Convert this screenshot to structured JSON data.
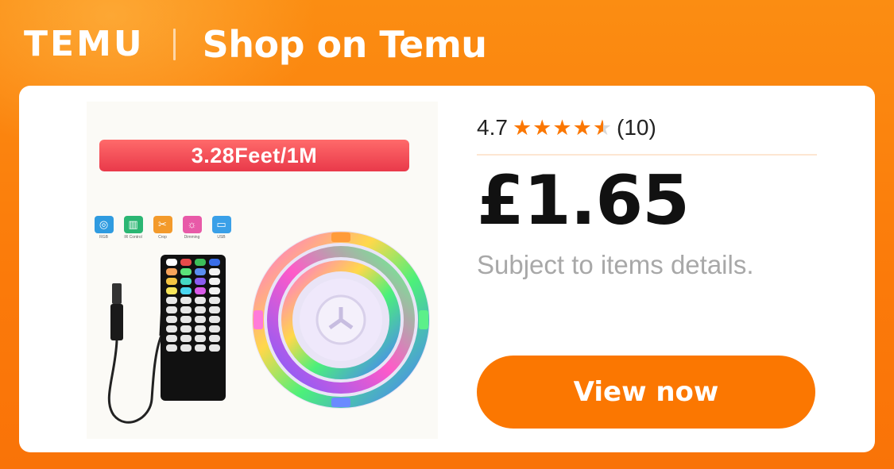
{
  "header": {
    "logo": "TEMU",
    "title": "Shop on Temu"
  },
  "product": {
    "image": {
      "length_label": "3.28Feet/1M",
      "features": [
        {
          "label": "RGB",
          "icon": "rgb-circles-icon",
          "color": "#2f9be0"
        },
        {
          "label": "IR Control",
          "icon": "remote-icon",
          "color": "#2bb673"
        },
        {
          "label": "Crop",
          "icon": "scissors-icon",
          "color": "#f39a2b"
        },
        {
          "label": "Dimming",
          "icon": "sun-icon",
          "color": "#e85aa8"
        },
        {
          "label": "USB",
          "icon": "usb-icon",
          "color": "#3aa0e8"
        }
      ]
    },
    "rating": {
      "score": "4.7",
      "stars": 4.7,
      "count": "(10)"
    },
    "price": "£1.65",
    "subtitle": "Subject to items details.",
    "cta_label": "View now"
  },
  "colors": {
    "brand_orange": "#fb7701",
    "star": "#fb7701",
    "price_text": "#111111",
    "muted_text": "#a8a8a8"
  }
}
